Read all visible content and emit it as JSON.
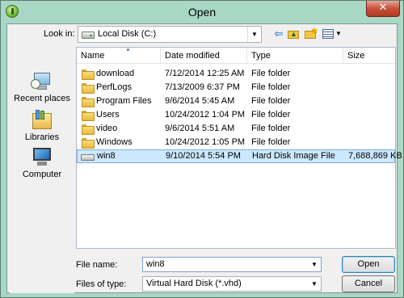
{
  "window": {
    "title": "Open",
    "close_glyph": "✕"
  },
  "toolbar": {
    "look_in_label": "Look in:",
    "look_in_value": "Local Disk (C:)",
    "icons": [
      "back-icon",
      "up-folder-icon",
      "new-folder-icon",
      "views-menu-icon"
    ]
  },
  "places": [
    {
      "label": "Recent places",
      "icon": "recent-places-icon"
    },
    {
      "label": "Libraries",
      "icon": "libraries-icon"
    },
    {
      "label": "Computer",
      "icon": "computer-icon"
    }
  ],
  "columns": {
    "name": "Name",
    "date": "Date modified",
    "type": "Type",
    "size": "Size"
  },
  "files": [
    {
      "name": "download",
      "date": "7/12/2014 12:25 AM",
      "type": "File folder",
      "size": ""
    },
    {
      "name": "PerfLogs",
      "date": "7/13/2009 6:37 PM",
      "type": "File folder",
      "size": ""
    },
    {
      "name": "Program Files",
      "date": "9/6/2014 5:45 AM",
      "type": "File folder",
      "size": ""
    },
    {
      "name": "Users",
      "date": "10/24/2012 1:04 PM",
      "type": "File folder",
      "size": ""
    },
    {
      "name": "video",
      "date": "9/6/2014 5:51 AM",
      "type": "File folder",
      "size": ""
    },
    {
      "name": "Windows",
      "date": "10/24/2012 1:05 PM",
      "type": "File folder",
      "size": ""
    },
    {
      "name": "win8",
      "date": "9/10/2014 5:54 PM",
      "type": "Hard Disk Image File",
      "size": "7,688,869 KB",
      "selected": true
    }
  ],
  "form": {
    "file_name_label": "File name:",
    "file_name_value": "win8",
    "file_type_label": "Files of type:",
    "file_type_value": "Virtual Hard Disk (*.vhd)"
  },
  "buttons": {
    "open": "Open",
    "cancel": "Cancel"
  },
  "colors": {
    "titlebar": "#a9d7c5",
    "selection": "#cce8ff",
    "folder": "#e9b93f",
    "close": "#c7503a"
  }
}
